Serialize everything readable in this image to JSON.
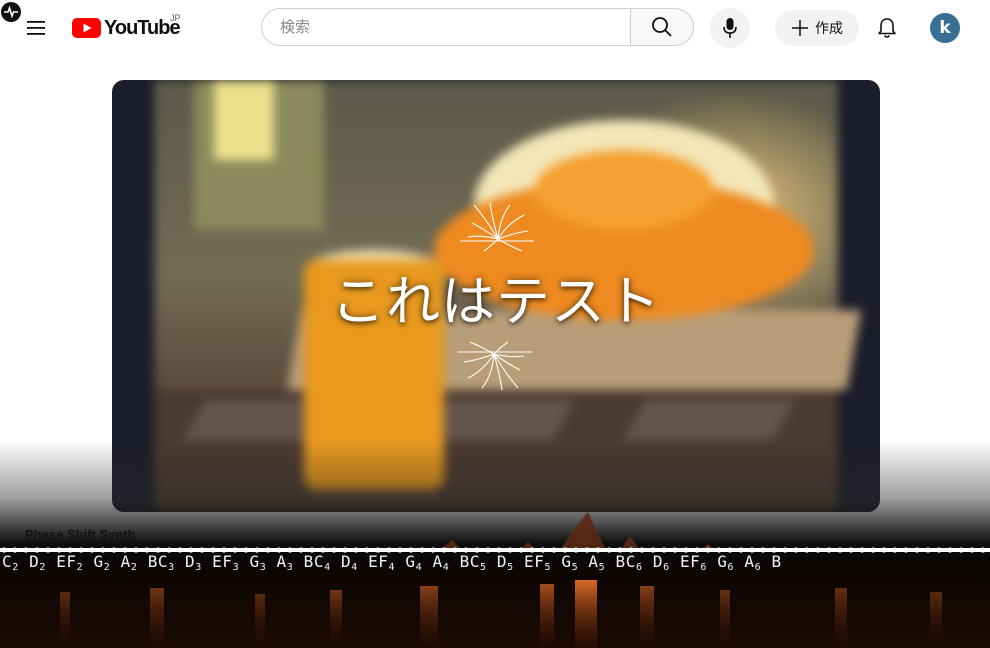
{
  "header": {
    "logo_text": "YouTube",
    "country_code": "JP",
    "search": {
      "placeholder": "検索",
      "value": ""
    },
    "create_label": "作成",
    "avatar_letter": "k",
    "colors": {
      "logo_red": "#ff0000",
      "control_bg": "#f2f2f2"
    }
  },
  "player": {
    "title": "これはテスト",
    "colors": {
      "frame": "#1c1d2a",
      "orange": "#ee8a20"
    }
  },
  "visualizer": {
    "title": "Phase Shift Synth",
    "notes": [
      "C",
      "2",
      "D",
      "2",
      "EF",
      "2",
      "G",
      "2",
      "A",
      "2",
      "BC",
      "3",
      "D",
      "3",
      "EF",
      "3",
      "G",
      "3",
      "A",
      "3",
      "BC",
      "4",
      "D",
      "4",
      "EF",
      "4",
      "G",
      "4",
      "A",
      "4",
      "BC",
      "5",
      "D",
      "5",
      "EF",
      "5",
      "G",
      "5",
      "A",
      "5",
      "BC",
      "6",
      "D",
      "6",
      "EF",
      "6",
      "G",
      "6",
      "A",
      "6",
      "B",
      ""
    ],
    "colors": {
      "glow": "#e06018",
      "line": "#ffffff"
    }
  }
}
